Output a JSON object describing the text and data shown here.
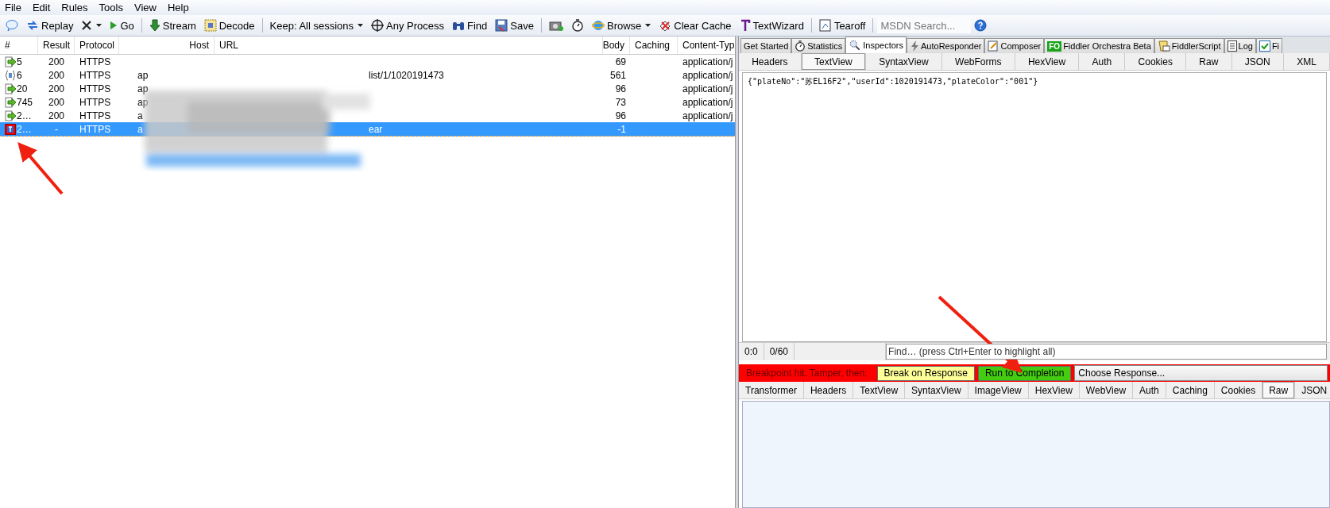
{
  "menu": [
    {
      "label": "File"
    },
    {
      "label": "Edit"
    },
    {
      "label": "Rules"
    },
    {
      "label": "Tools"
    },
    {
      "label": "View"
    },
    {
      "label": "Help"
    }
  ],
  "toolbar": [
    {
      "kind": "comment",
      "dropdown": false
    },
    {
      "kind": "replay",
      "label": "Replay",
      "dropdown": false
    },
    {
      "kind": "remove",
      "dropdown": true
    },
    {
      "kind": "go",
      "label": "Go",
      "dropdown": false
    },
    {
      "kind": "separator"
    },
    {
      "kind": "stream",
      "label": "Stream",
      "dropdown": false
    },
    {
      "kind": "decode",
      "label": "Decode",
      "dropdown": false
    },
    {
      "kind": "separator"
    },
    {
      "kind": "plain",
      "label": "Keep: All sessions",
      "dropdown": true
    },
    {
      "kind": "target",
      "label": "Any Process",
      "dropdown": false
    },
    {
      "kind": "find",
      "label": "Find",
      "dropdown": false
    },
    {
      "kind": "save",
      "label": "Save",
      "dropdown": false
    },
    {
      "kind": "separator"
    },
    {
      "kind": "camera",
      "dropdown": false
    },
    {
      "kind": "timer",
      "dropdown": false
    },
    {
      "kind": "browse",
      "label": "Browse",
      "dropdown": true
    },
    {
      "kind": "clear",
      "label": "Clear Cache",
      "dropdown": false
    },
    {
      "kind": "textwizard",
      "label": "TextWizard",
      "dropdown": false
    },
    {
      "kind": "separator"
    },
    {
      "kind": "tearoff",
      "label": "Tearoff",
      "dropdown": false
    },
    {
      "kind": "separator"
    },
    {
      "kind": "search",
      "placeholder": "MSDN Search..."
    },
    {
      "kind": "help"
    }
  ],
  "sessions": {
    "columns": [
      "#",
      "Result",
      "Protocol",
      "Host",
      "URL",
      "Body",
      "Caching",
      "Content-Typ"
    ],
    "rows": [
      {
        "kind": "response",
        "num": "5",
        "result": "200",
        "protocol": "HTTPS",
        "body": "69",
        "content_type": "application/j",
        "selected": false
      },
      {
        "kind": "script",
        "num": "6",
        "result": "200",
        "protocol": "HTTPS",
        "host": "ap",
        "url": "list/1/1020191473",
        "body": "561",
        "content_type": "application/j",
        "selected": false
      },
      {
        "kind": "response",
        "num": "20",
        "result": "200",
        "protocol": "HTTPS",
        "host": "ap",
        "body": "96",
        "content_type": "application/j",
        "selected": false
      },
      {
        "kind": "response",
        "num": "745",
        "result": "200",
        "protocol": "HTTPS",
        "host": "ap",
        "body": "73",
        "content_type": "application/j",
        "selected": false
      },
      {
        "kind": "response",
        "num": "2…",
        "result": "200",
        "protocol": "HTTPS",
        "host": "a",
        "body": "96",
        "content_type": "application/j",
        "selected": false
      },
      {
        "kind": "breakpoint",
        "num": "2…",
        "result": "-",
        "protocol": "HTTPS",
        "host": "a",
        "url": "ear",
        "body": "-1",
        "selected": true
      }
    ]
  },
  "tabs": [
    {
      "label": "Get Started",
      "kind": "plain",
      "selected": false
    },
    {
      "label": "Statistics",
      "kind": "timer",
      "selected": false
    },
    {
      "label": "Inspectors",
      "kind": "inspect",
      "selected": true
    },
    {
      "label": "AutoResponder",
      "kind": "bolt",
      "selected": false
    },
    {
      "label": "Composer",
      "kind": "compose",
      "selected": false
    },
    {
      "label": "Fiddler Orchestra Beta",
      "kind": "badge",
      "badge": "FO",
      "selected": false
    },
    {
      "label": "FiddlerScript",
      "kind": "script",
      "selected": false
    },
    {
      "label": "Log",
      "kind": "log",
      "selected": false
    },
    {
      "label": "Fi",
      "kind": "check",
      "selected": false
    }
  ],
  "request": {
    "tabs": [
      {
        "label": "Headers",
        "selected": false
      },
      {
        "label": "TextView",
        "selected": true
      },
      {
        "label": "SyntaxView",
        "selected": false
      },
      {
        "label": "WebForms",
        "selected": false
      },
      {
        "label": "HexView",
        "selected": false
      },
      {
        "label": "Auth",
        "selected": false
      },
      {
        "label": "Cookies",
        "selected": false
      },
      {
        "label": "Raw",
        "selected": false
      },
      {
        "label": "JSON",
        "selected": false
      },
      {
        "label": "XML",
        "selected": false
      }
    ],
    "body": "{\"plateNo\":\"苏EL16F2\",\"userId\":1020191473,\"plateColor\":\"001\"}",
    "status": [
      "0:0",
      "0/60"
    ],
    "find": {
      "placeholder": "Find… (press Ctrl+Enter to highlight all)"
    }
  },
  "breakpoint": {
    "message": "Breakpoint hit. Tamper, then:",
    "buttons": [
      {
        "label": "Break on Response",
        "kind": "break"
      },
      {
        "label": "Run to Completion",
        "kind": "run"
      }
    ],
    "response_choice": "Choose Response..."
  },
  "response": {
    "tabs": [
      {
        "label": "Transformer",
        "selected": false
      },
      {
        "label": "Headers",
        "selected": false
      },
      {
        "label": "TextView",
        "selected": false
      },
      {
        "label": "SyntaxView",
        "selected": false
      },
      {
        "label": "ImageView",
        "selected": false
      },
      {
        "label": "HexView",
        "selected": false
      },
      {
        "label": "WebView",
        "selected": false
      },
      {
        "label": "Auth",
        "selected": false
      },
      {
        "label": "Caching",
        "selected": false
      },
      {
        "label": "Cookies",
        "selected": false
      },
      {
        "label": "Raw",
        "selected": true
      },
      {
        "label": "JSON",
        "selected": false
      }
    ]
  }
}
